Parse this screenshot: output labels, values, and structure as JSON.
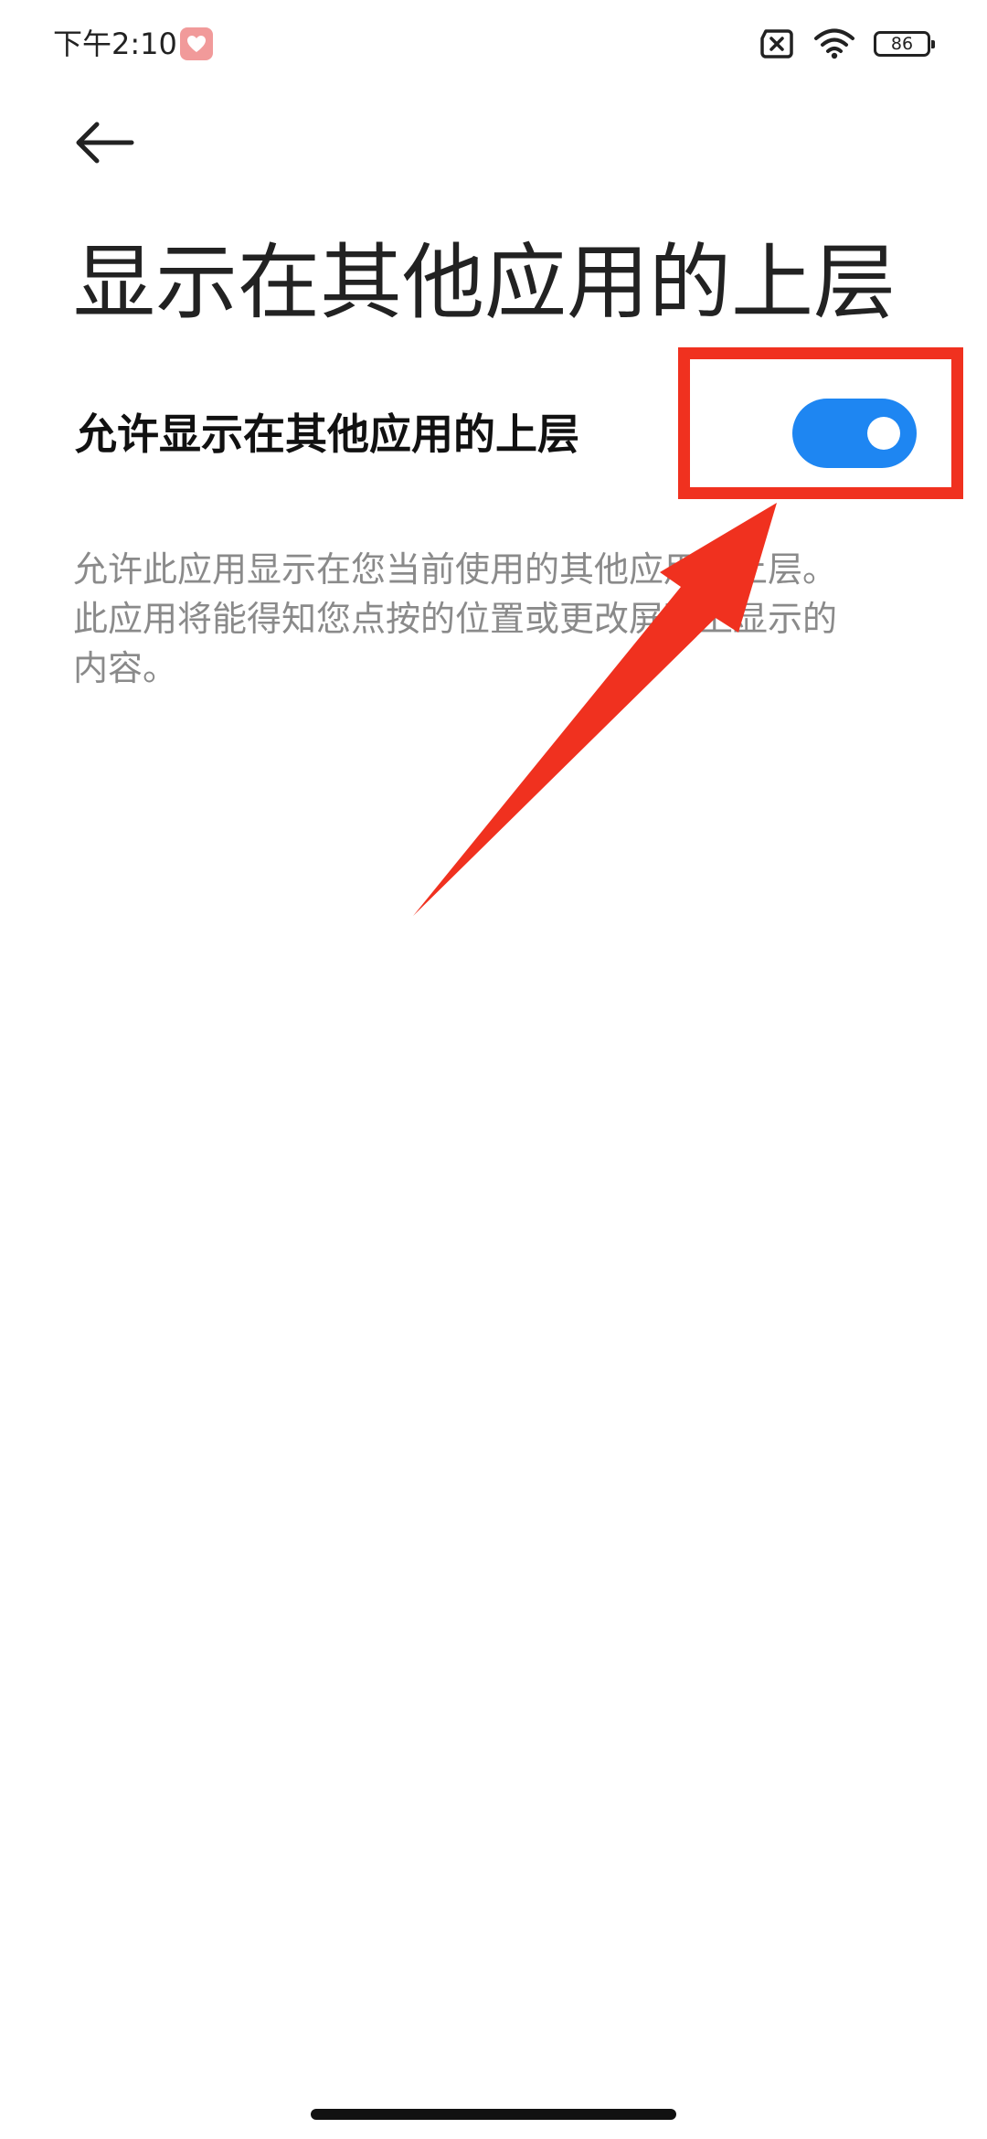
{
  "status_bar": {
    "time": "下午2:10",
    "battery_level": "86",
    "app_icon": "heart-app-icon",
    "sim_icon": "sim-x-icon",
    "wifi_icon": "wifi-icon"
  },
  "nav": {
    "back_icon": "back-arrow-icon"
  },
  "page": {
    "title": "显示在其他应用的上层"
  },
  "setting": {
    "label": "允许显示在其他应用的上层",
    "enabled": true,
    "description": "允许此应用显示在您当前使用的其他应用的上层。此应用将能得知您点按的位置或更改屏幕上显示的内容。"
  },
  "colors": {
    "toggle_on": "#1e86f2",
    "annotation": "#f0311f",
    "text_secondary": "#8a8a8a"
  }
}
